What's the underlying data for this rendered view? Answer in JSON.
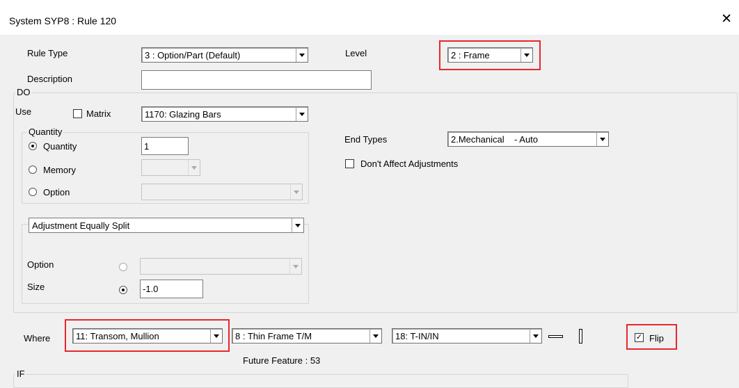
{
  "window": {
    "title": "System SYP8 : Rule 120"
  },
  "rule_type": {
    "label": "Rule Type",
    "value": "3 : Option/Part (Default)"
  },
  "level": {
    "label": "Level",
    "value": "2 : Frame"
  },
  "description": {
    "label": "Description",
    "value": ""
  },
  "do_group": {
    "label": "DO",
    "use_label": "Use",
    "matrix_label": "Matrix",
    "matrix_checked": false,
    "use_value": "1170: Glazing Bars",
    "end_types_label": "End Types",
    "end_types_value": "2.Mechanical    - Auto",
    "dont_affect_label": "Don't Affect Adjustments",
    "quantity_group": {
      "label": "Quantity",
      "quantity_label": "Quantity",
      "quantity_value": "1",
      "memory_label": "Memory",
      "option_label": "Option"
    },
    "adjustment": {
      "value": "Adjustment Equally Split",
      "option_label": "Option",
      "size_label": "Size",
      "size_value": "-1.0"
    }
  },
  "where": {
    "label": "Where",
    "combo1": "11: Transom, Mullion",
    "combo2": "8 : Thin Frame T/M",
    "combo3": "18: T-IN/IN",
    "flip_label": "Flip",
    "flip_checked": true
  },
  "future_feature": "Future Feature :  53",
  "if_group": {
    "label": "IF"
  },
  "colors": {
    "highlight": "#e8262b",
    "background": "#f0f0f0"
  }
}
